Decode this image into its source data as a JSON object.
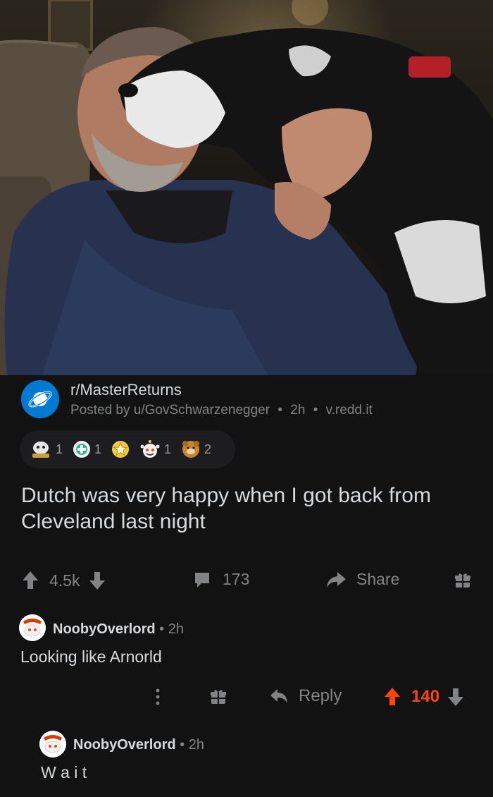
{
  "post": {
    "subreddit": "r/MasterReturns",
    "meta_prefix": "Posted by",
    "author": "u/GovSchwarzenegger",
    "time": "2h",
    "domain": "v.redd.it",
    "title": "Dutch was very happy when I got back from Cleveland last night",
    "awards": [
      {
        "icon": "wholesome-seal-award-icon",
        "count": "1"
      },
      {
        "icon": "green-cross-award-icon",
        "count": "1"
      },
      {
        "icon": "star-award-icon",
        "count": ""
      },
      {
        "icon": "excited-snoo-award-icon",
        "count": "1"
      },
      {
        "icon": "bear-hug-award-icon",
        "count": "2"
      }
    ],
    "score": "4.5k",
    "comments": "173",
    "share_label": "Share"
  },
  "comments": [
    {
      "author": "NoobyOverlord",
      "time": "2h",
      "body": "Looking like Arnorld",
      "reply_label": "Reply",
      "score": "140",
      "upvoted": true
    },
    {
      "author": "NoobyOverlord",
      "time": "2h",
      "body": "W a i t"
    }
  ],
  "colors": {
    "background": "#121212",
    "text": "#d7dadc",
    "muted": "#818384",
    "upvote": "#ff4500",
    "subreddit_icon": "#0079d3"
  }
}
